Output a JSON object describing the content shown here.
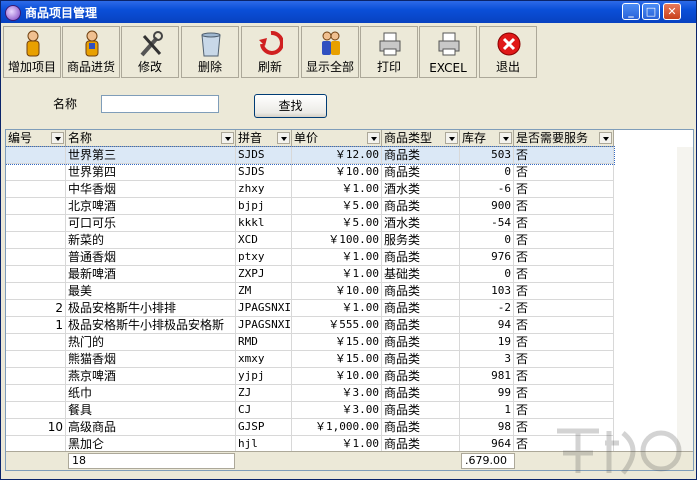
{
  "window": {
    "title": "商品项目管理"
  },
  "toolbar": {
    "buttons": [
      {
        "label": "增加项目",
        "icon": "person-add-icon"
      },
      {
        "label": "商品进货",
        "icon": "person-stock-icon"
      },
      {
        "label": "修改",
        "icon": "tools-icon"
      },
      {
        "label": "删除",
        "icon": "trash-icon"
      },
      {
        "label": "刷新",
        "icon": "refresh-icon"
      },
      {
        "label": "显示全部",
        "icon": "group-icon"
      },
      {
        "label": "打印",
        "icon": "printer-icon"
      },
      {
        "label": "EXCEL",
        "icon": "excel-printer-icon"
      },
      {
        "label": "退出",
        "icon": "exit-icon"
      }
    ]
  },
  "search": {
    "label": "名称",
    "value": "",
    "button": "查找"
  },
  "table": {
    "columns": [
      "编号",
      "名称",
      "拼音",
      "单价",
      "商品类型",
      "库存",
      "是否需要服务"
    ],
    "rows": [
      [
        "",
        "世界第三",
        "SJDS",
        "￥12.00",
        "商品类",
        "503",
        "否"
      ],
      [
        "",
        "世界第四",
        "SJDS",
        "￥10.00",
        "商品类",
        "0",
        "否"
      ],
      [
        "",
        "中华香烟",
        "zhxy",
        "￥1.00",
        "酒水类",
        "-6",
        "否"
      ],
      [
        "",
        "北京啤酒",
        "bjpj",
        "￥5.00",
        "商品类",
        "900",
        "否"
      ],
      [
        "",
        "可口可乐",
        "kkkl",
        "￥5.00",
        "酒水类",
        "-54",
        "否"
      ],
      [
        "",
        "新菜的",
        "XCD",
        "￥100.00",
        "服务类",
        "0",
        "否"
      ],
      [
        "",
        "普通香烟",
        "ptxy",
        "￥1.00",
        "商品类",
        "976",
        "否"
      ],
      [
        "",
        "最新啤酒",
        "ZXPJ",
        "￥1.00",
        "基础类",
        "0",
        "否"
      ],
      [
        "",
        "最美",
        "ZM",
        "￥10.00",
        "商品类",
        "103",
        "否"
      ],
      [
        "2",
        "极品安格斯牛小排排",
        "JPAGSNXI",
        "￥1.00",
        "商品类",
        "-2",
        "否"
      ],
      [
        "1",
        "极品安格斯牛小排极品安格斯",
        "JPAGSNXI",
        "￥555.00",
        "商品类",
        "94",
        "否"
      ],
      [
        "",
        "热门的",
        "RMD",
        "￥15.00",
        "商品类",
        "19",
        "否"
      ],
      [
        "",
        "熊猫香烟",
        "xmxy",
        "￥15.00",
        "商品类",
        "3",
        "否"
      ],
      [
        "",
        "燕京啤酒",
        "yjpj",
        "￥10.00",
        "商品类",
        "981",
        "否"
      ],
      [
        "",
        "纸巾",
        "ZJ",
        "￥3.00",
        "商品类",
        "99",
        "否"
      ],
      [
        "",
        "餐具",
        "CJ",
        "￥3.00",
        "商品类",
        "1",
        "否"
      ],
      [
        "10",
        "高级商品",
        "GJSP",
        "￥1,000.00",
        "商品类",
        "98",
        "否"
      ],
      [
        "",
        "黑加仑",
        "hjl",
        "￥1.00",
        "商品类",
        "964",
        "否"
      ]
    ],
    "footer": {
      "count": "18",
      "total": ".679.00"
    }
  },
  "colors": {
    "title_bar": "#0a4fd8",
    "selection": "#dbe8f6",
    "face": "#ece9d8"
  }
}
